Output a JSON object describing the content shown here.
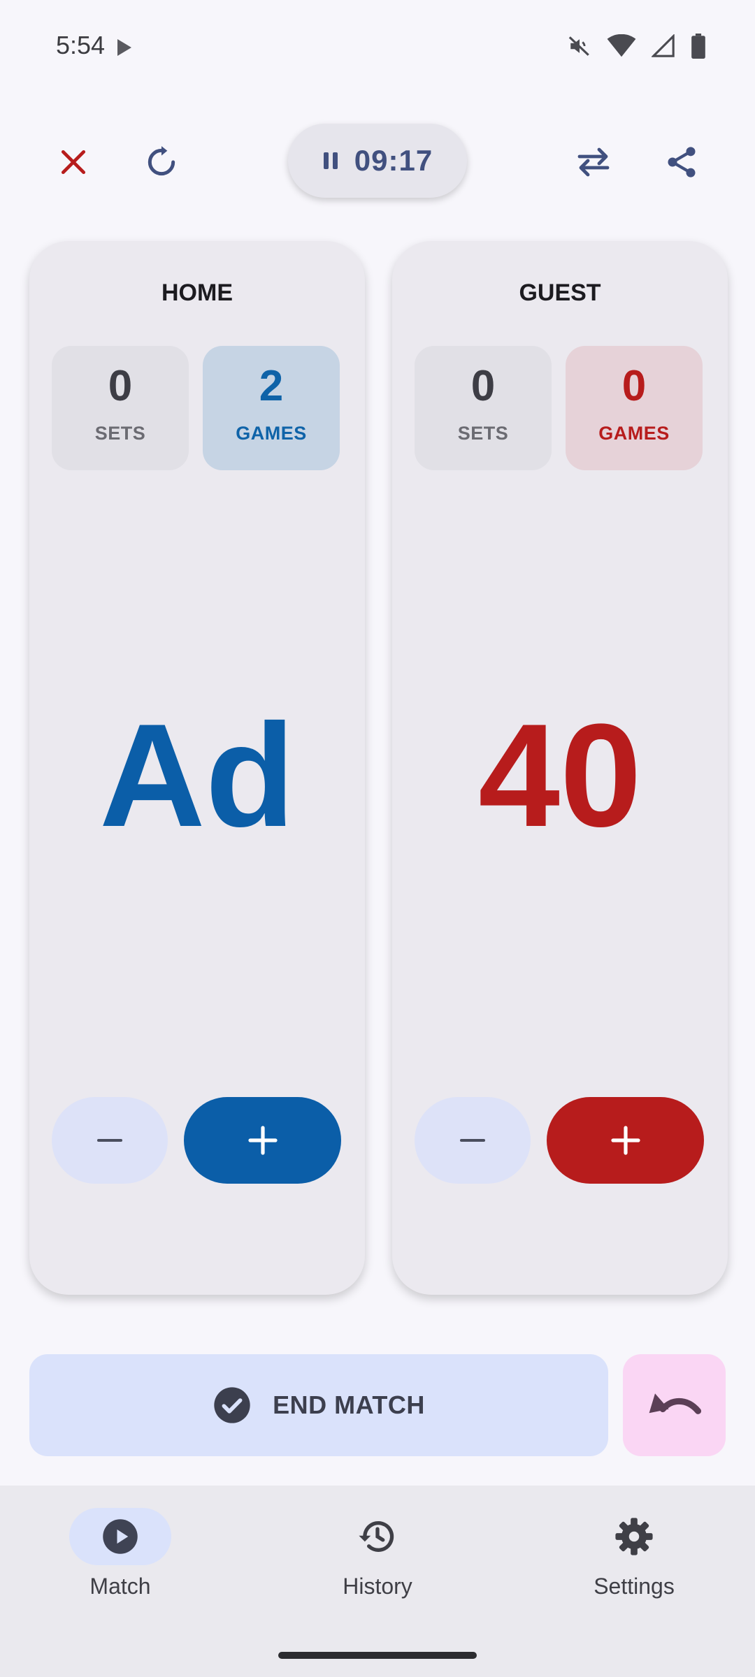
{
  "status_bar": {
    "time": "5:54",
    "icons": [
      "play-icon",
      "mute-icon",
      "wifi-icon",
      "signal-icon",
      "battery-icon"
    ]
  },
  "toolbar": {
    "close_icon": "close-icon",
    "reset_icon": "refresh-icon",
    "timer": "09:17",
    "timer_state": "paused-icon",
    "swap_icon": "swap-icon",
    "share_icon": "share-icon"
  },
  "home": {
    "name": "HOME",
    "sets": "0",
    "sets_label": "SETS",
    "games": "2",
    "games_label": "GAMES",
    "score": "Ad",
    "color": "#0b5ea8"
  },
  "guest": {
    "name": "GUEST",
    "sets": "0",
    "sets_label": "SETS",
    "games": "0",
    "games_label": "GAMES",
    "score": "40",
    "color": "#b71c1c"
  },
  "actions": {
    "end_match_label": "END MATCH",
    "undo_icon": "undo-icon"
  },
  "nav": {
    "items": [
      {
        "label": "Match",
        "icon": "play-circle-icon",
        "active": true
      },
      {
        "label": "History",
        "icon": "history-icon",
        "active": false
      },
      {
        "label": "Settings",
        "icon": "gear-icon",
        "active": false
      }
    ]
  }
}
